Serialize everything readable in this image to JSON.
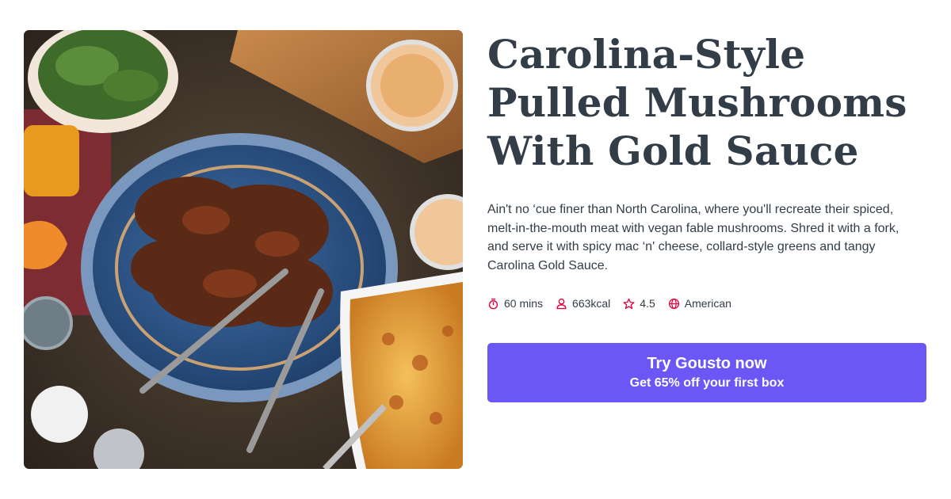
{
  "recipe": {
    "title": "Carolina-Style Pulled Mushrooms With Gold Sauce",
    "description": "Ain't no ‘cue finer than North Carolina, where you'll recreate their spiced, melt-in-the-mouth meat with vegan fable mushrooms. Shred it with a fork, and serve it with spicy mac ‘n' cheese, collard-style greens and tangy Carolina Gold Sauce.",
    "meta": {
      "time": "60 mins",
      "calories": "663kcal",
      "rating": "4.5",
      "cuisine": "American"
    }
  },
  "icons": {
    "time": "stopwatch-icon",
    "calories": "person-icon",
    "rating": "star-icon",
    "cuisine": "globe-icon"
  },
  "cta": {
    "title": "Try Gousto now",
    "subtitle": "Get 65% off your first box"
  },
  "colors": {
    "accent": "#6b57f5",
    "icon": "#e4003b",
    "text": "#333d47"
  }
}
